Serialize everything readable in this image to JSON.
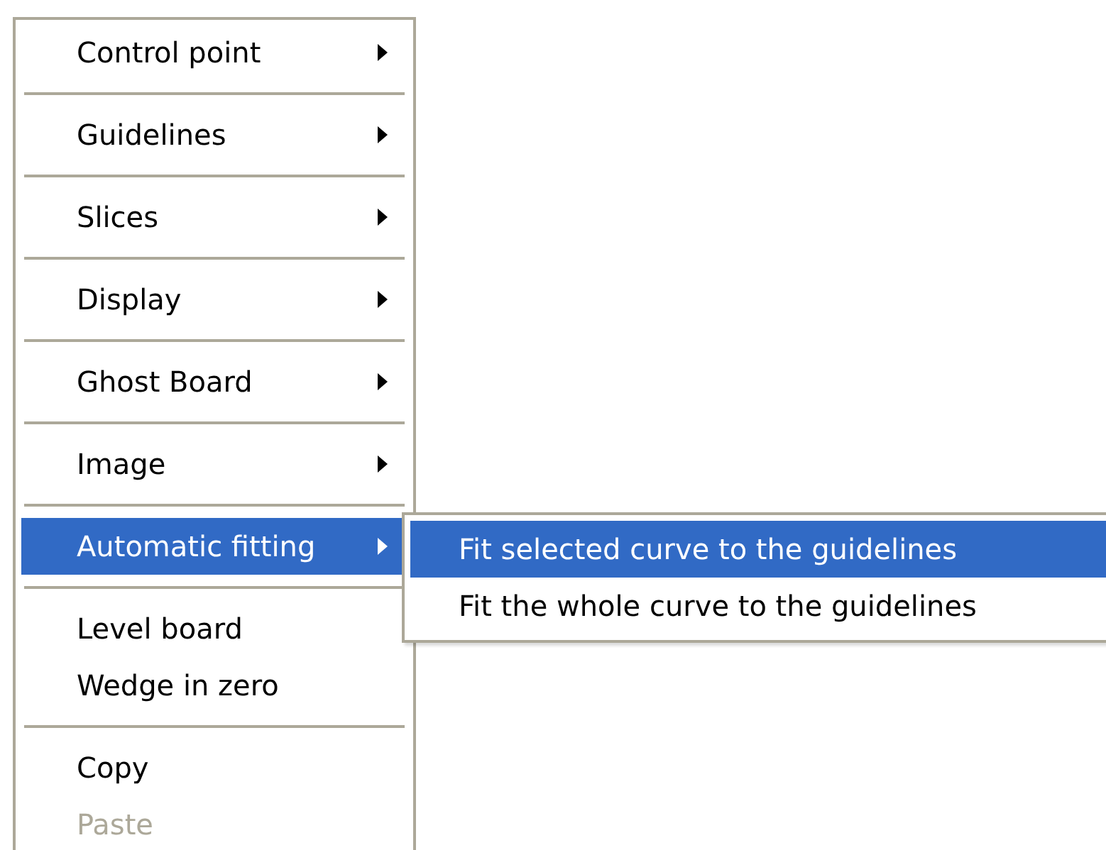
{
  "menu": {
    "items": [
      {
        "kind": "item",
        "label": "Control point",
        "has_submenu": true,
        "selected": false,
        "disabled": false
      },
      {
        "kind": "separator"
      },
      {
        "kind": "item",
        "label": "Guidelines",
        "has_submenu": true,
        "selected": false,
        "disabled": false
      },
      {
        "kind": "separator"
      },
      {
        "kind": "item",
        "label": "Slices",
        "has_submenu": true,
        "selected": false,
        "disabled": false
      },
      {
        "kind": "separator"
      },
      {
        "kind": "item",
        "label": "Display",
        "has_submenu": true,
        "selected": false,
        "disabled": false
      },
      {
        "kind": "separator"
      },
      {
        "kind": "item",
        "label": "Ghost Board",
        "has_submenu": true,
        "selected": false,
        "disabled": false
      },
      {
        "kind": "separator"
      },
      {
        "kind": "item",
        "label": "Image",
        "has_submenu": true,
        "selected": false,
        "disabled": false
      },
      {
        "kind": "separator"
      },
      {
        "kind": "item",
        "label": "Automatic fitting",
        "has_submenu": true,
        "selected": true,
        "disabled": false
      },
      {
        "kind": "separator"
      },
      {
        "kind": "item",
        "label": "Level board",
        "has_submenu": false,
        "selected": false,
        "disabled": false
      },
      {
        "kind": "item",
        "label": "Wedge in zero",
        "has_submenu": false,
        "selected": false,
        "disabled": false
      },
      {
        "kind": "separator"
      },
      {
        "kind": "item",
        "label": "Copy",
        "has_submenu": false,
        "selected": false,
        "disabled": false
      },
      {
        "kind": "item",
        "label": "Paste",
        "has_submenu": false,
        "selected": false,
        "disabled": true
      }
    ]
  },
  "submenu": {
    "items": [
      {
        "kind": "item",
        "label": "Fit selected curve to the guidelines",
        "selected": true,
        "disabled": false
      },
      {
        "kind": "item",
        "label": "Fit the whole curve to the guidelines",
        "selected": false,
        "disabled": false
      }
    ]
  }
}
